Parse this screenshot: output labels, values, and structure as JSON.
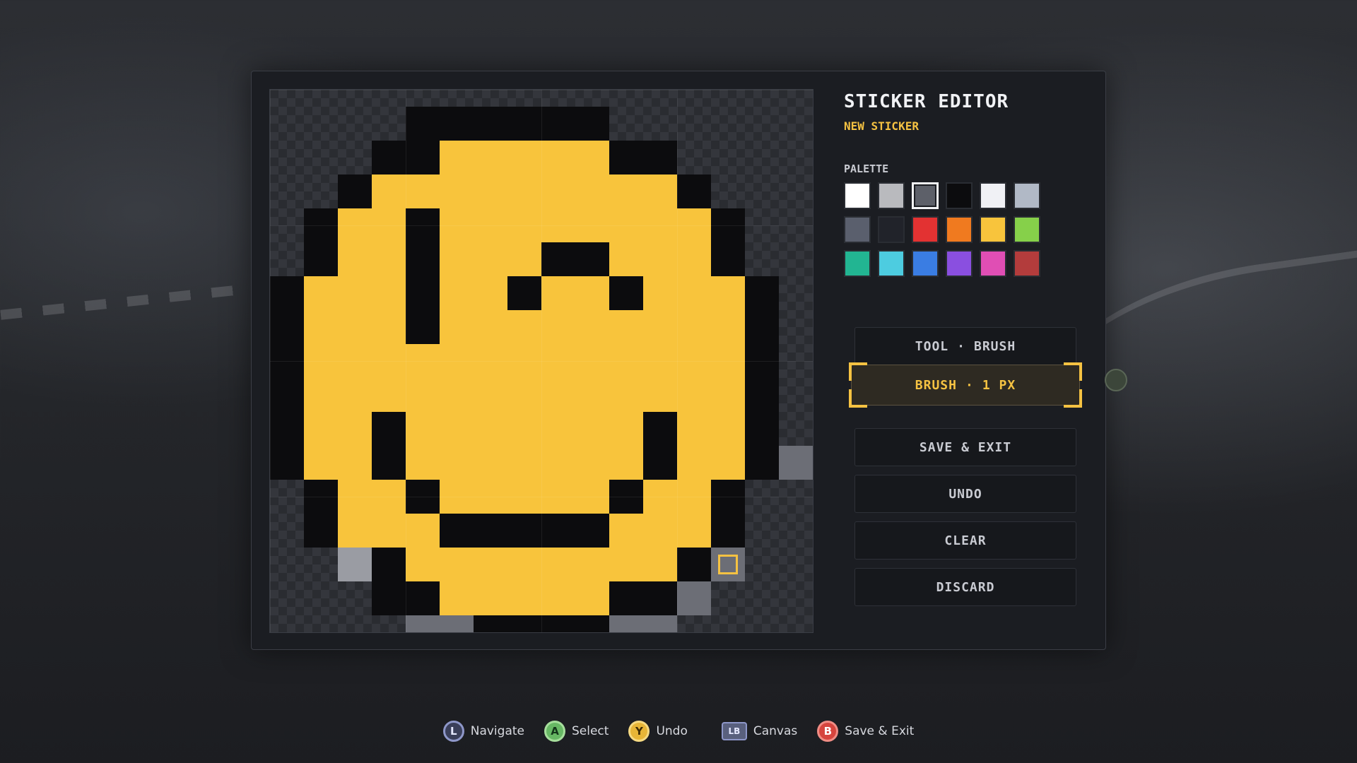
{
  "editor": {
    "title": "STICKER EDITOR",
    "subtitle": "NEW STICKER",
    "palette_label": "PALETTE",
    "palette": [
      "#ffffff",
      "#b9babe",
      "#5d6069",
      "#0c0c0e",
      "#f0f1f5",
      "#b1b9c6",
      "#5a5f6d",
      "#21232a",
      "#e33232",
      "#f07a1f",
      "#f8c43c",
      "#86d04a",
      "#22b592",
      "#4dcce0",
      "#3a7de3",
      "#8a4fe0",
      "#e04eb4",
      "#b33c3c"
    ],
    "selected_palette_index": 2,
    "buttons": {
      "tool": {
        "prefix": "TOOL",
        "sep": "·",
        "value": "BRUSH"
      },
      "brush": {
        "prefix": "BRUSH",
        "sep": "·",
        "value": "1 PX"
      },
      "save_exit": "SAVE & EXIT",
      "undo": "UNDO",
      "clear": "CLEAR",
      "discard": "DISCARD"
    }
  },
  "sticker": {
    "grid_size": 16,
    "legend": {
      "Y": "#f8c43c",
      "K": "#0c0c0e",
      "G": "#6c6e76",
      "L": "#9a9ca3"
    },
    "rows": [
      "................",
      "....KKKKKK......",
      "...KKYYYYYKK....",
      "..KYYYYYYYYYK...",
      ".KYYKYYYYYYYYK..",
      ".KYYKYYYKKYYYK..",
      "KYYYKYYKYYKYYYK.",
      "KYYYKYYYYYYYYYK.",
      "KYYYYYYYYYYYYYK.",
      "KYYYYYYYYYYYYYK.",
      "KYYKYYYYYYYKYYK.",
      "KYYKYYYYYYYKYYKG",
      ".KYYKYYYYYKYYK..",
      ".KYYYKKKKKYYYK..",
      "..LKYYYYYYYYKG..",
      "...KKYYYYYKKG...",
      "....GGKKKKGG....",
      "......GGGG......"
    ],
    "cursor": {
      "row": 14,
      "col": 13
    }
  },
  "hints": [
    {
      "icon": "stick-icon",
      "glyph": "L",
      "label": "Navigate"
    },
    {
      "icon": "a-button-icon",
      "glyph": "A",
      "label": "Select"
    },
    {
      "icon": "y-button-icon",
      "glyph": "Y",
      "label": "Undo"
    },
    {
      "icon": "lb-button-icon",
      "glyph": "LB",
      "label": "Canvas"
    },
    {
      "icon": "b-button-icon",
      "glyph": "B",
      "label": "Save & Exit"
    }
  ]
}
